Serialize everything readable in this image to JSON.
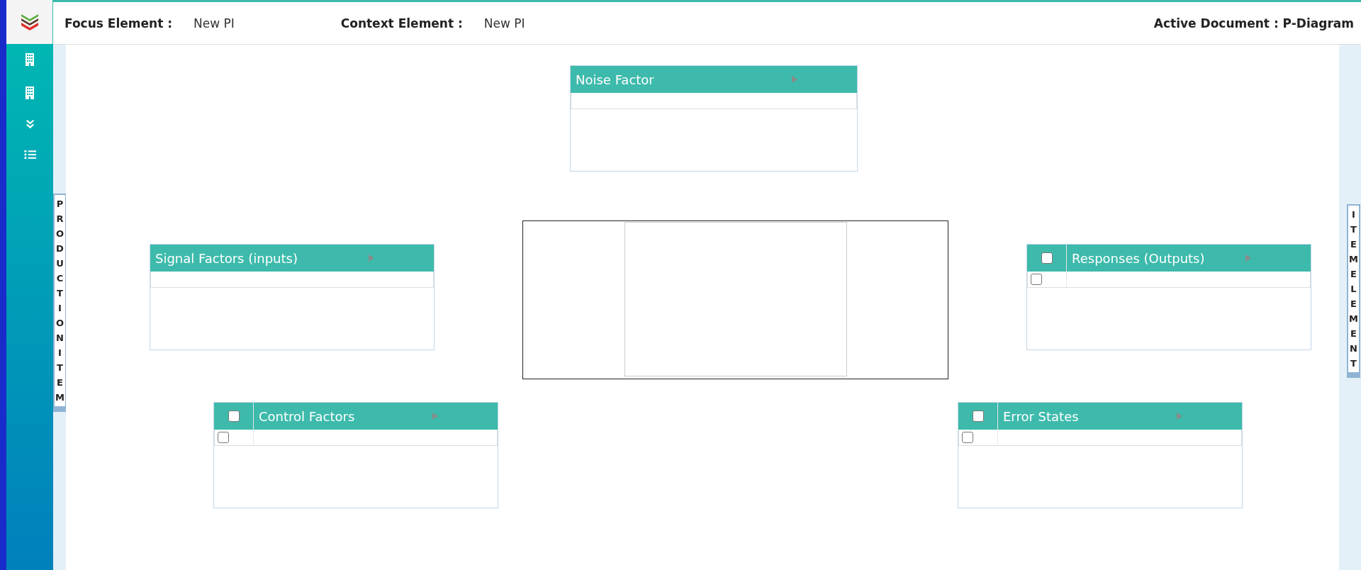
{
  "header": {
    "focus_label": "Focus Element :",
    "focus_value": "New PI",
    "context_label": "Context Element :",
    "context_value": "New PI",
    "active_document": "Active Document : P-Diagram"
  },
  "left_tab": {
    "label": "PRODUCTION ITEM"
  },
  "right_tab": {
    "label": "ITEM ELEMENT"
  },
  "panels": [
    {
      "title": "Noise Factor",
      "kind": "plain"
    },
    {
      "title": "Signal Factors (inputs)",
      "kind": "plain"
    },
    {
      "title": "Responses (Outputs)",
      "kind": "checklist",
      "header_checked": false,
      "row_checked": false
    },
    {
      "title": "Control Factors",
      "kind": "checklist",
      "header_checked": false,
      "row_checked": false
    },
    {
      "title": "Error States",
      "kind": "checklist",
      "header_checked": false,
      "row_checked": false
    }
  ]
}
